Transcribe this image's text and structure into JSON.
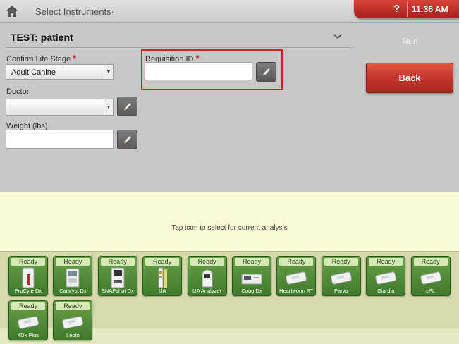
{
  "topbar": {
    "breadcrumb": "Select Instruments·",
    "help_label": "?",
    "time": "11:36 AM"
  },
  "patient": {
    "title": "TEST: patient"
  },
  "form": {
    "life_stage": {
      "label": "Confirm Life Stage",
      "required_mark": "*",
      "value": "Adult Canine"
    },
    "requisition": {
      "label": "Requisition ID",
      "required_mark": "*",
      "value": ""
    },
    "doctor": {
      "label": "Doctor",
      "value": ""
    },
    "weight": {
      "label": "Weight (lbs)",
      "value": ""
    }
  },
  "actions": {
    "run_label": "Run",
    "back_label": "Back"
  },
  "info": {
    "message": "Tap icon to select for current analysis"
  },
  "instruments": [
    {
      "status": "Ready",
      "name": "ProCyte Dx",
      "icon": "procyte-icon"
    },
    {
      "status": "Ready",
      "name": "Catalyst Dx",
      "icon": "catalyst-icon"
    },
    {
      "status": "Ready",
      "name": "SNAPshot Dx",
      "icon": "snapshot-icon"
    },
    {
      "status": "Ready",
      "name": "UA",
      "icon": "ua-strip-icon"
    },
    {
      "status": "Ready",
      "name": "UA Analyzer",
      "icon": "ua-analyzer-icon"
    },
    {
      "status": "Ready",
      "name": "Coag Dx",
      "icon": "coag-icon"
    },
    {
      "status": "Ready",
      "name": "Heartworm RT",
      "icon": "snap-test-icon"
    },
    {
      "status": "Ready",
      "name": "Parvo",
      "icon": "snap-test-icon"
    },
    {
      "status": "Ready",
      "name": "Giardia",
      "icon": "snap-test-icon"
    },
    {
      "status": "Ready",
      "name": "cPL",
      "icon": "snap-test-icon"
    },
    {
      "status": "Ready",
      "name": "4Dx Plus",
      "icon": "snap-test-icon"
    },
    {
      "status": "Ready",
      "name": "Lepto",
      "icon": "snap-test-icon"
    }
  ],
  "colors": {
    "accent_red": "#c1272d",
    "instrument_green": "#4e8a36",
    "info_yellow": "#fbfbd6"
  }
}
